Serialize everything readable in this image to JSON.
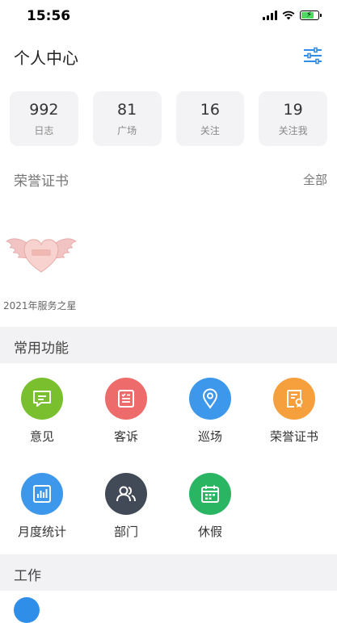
{
  "status_bar": {
    "time": "15:56"
  },
  "header": {
    "title": "个人中心",
    "settings_icon": "sliders-icon"
  },
  "stats": [
    {
      "value": "992",
      "label": "日志"
    },
    {
      "value": "81",
      "label": "广场"
    },
    {
      "value": "16",
      "label": "关注"
    },
    {
      "value": "19",
      "label": "关注我"
    }
  ],
  "honors": {
    "title": "荣誉证书",
    "all_label": "全部",
    "items": [
      {
        "caption": "2021年服务之星"
      }
    ]
  },
  "common_functions": {
    "title": "常用功能",
    "items": [
      {
        "label": "意见",
        "icon": "feedback-icon",
        "color": "#7ac02e"
      },
      {
        "label": "客诉",
        "icon": "complaint-icon",
        "color": "#ee6b6b"
      },
      {
        "label": "巡场",
        "icon": "location-pin-icon",
        "color": "#3d97ea"
      },
      {
        "label": "荣誉证书",
        "icon": "certificate-icon",
        "color": "#f5a03c"
      },
      {
        "label": "月度统计",
        "icon": "bar-chart-icon",
        "color": "#3d97ea"
      },
      {
        "label": "部门",
        "icon": "people-icon",
        "color": "#434a57"
      },
      {
        "label": "休假",
        "icon": "calendar-icon",
        "color": "#29b561"
      }
    ]
  },
  "work": {
    "title": "工作"
  }
}
